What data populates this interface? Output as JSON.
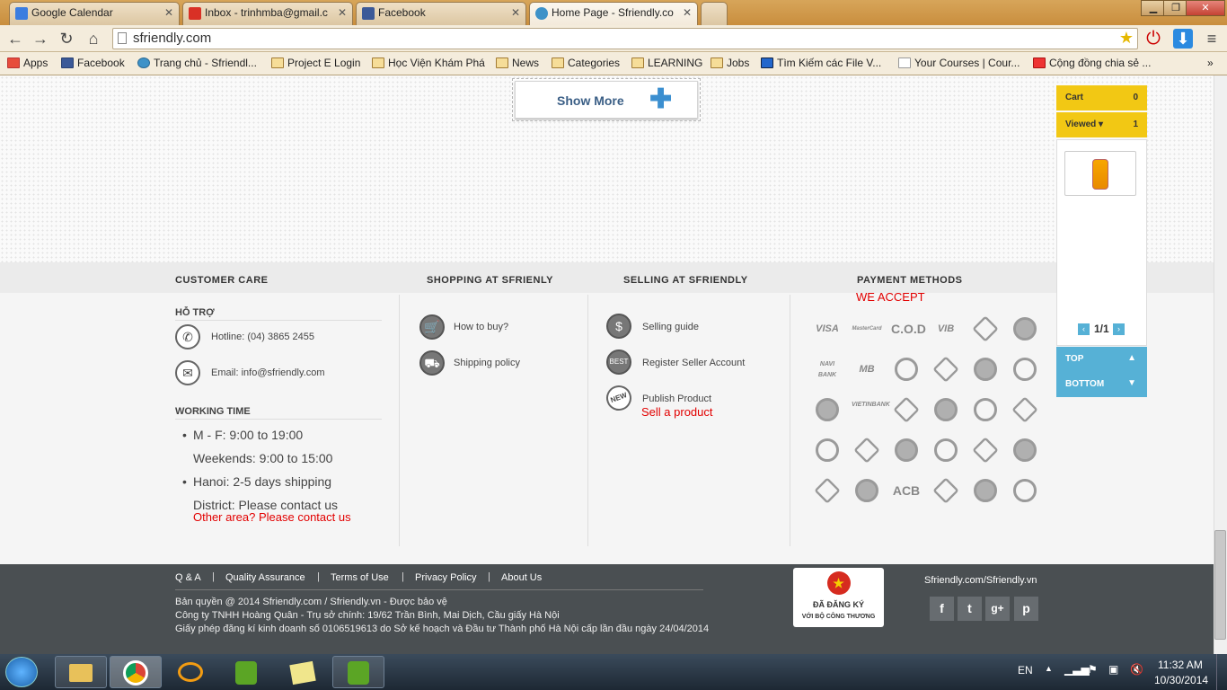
{
  "browser": {
    "tabs": [
      {
        "title": "Google Calendar",
        "favicon_color": "#3b7de0"
      },
      {
        "title": "Inbox - trinhmba@gmail.c",
        "favicon_color": "#d93025"
      },
      {
        "title": "Facebook",
        "favicon_color": "#3b5998"
      },
      {
        "title": "Home Page - Sfriendly.co",
        "favicon_color": "#3e92c8"
      }
    ],
    "url": "sfriendly.com",
    "bookmarks": [
      "Apps",
      "Facebook",
      "Trang chủ - Sfriendl...",
      "Project E Login",
      "Học Viện Khám Phá",
      "News",
      "Categories",
      "LEARNING",
      "Jobs",
      "Tìm Kiếm các File V...",
      "Your Courses | Cour...",
      "Cộng đồng chia sẻ ..."
    ]
  },
  "page": {
    "show_more": "Show More",
    "columns": {
      "customer_care": "CUSTOMER CARE",
      "shopping": "SHOPPING AT SFRIENLY",
      "selling": "SELLING AT SFRIENDLY",
      "payment": "PAYMENT METHODS"
    },
    "we_accept": "WE ACCEPT",
    "support": {
      "heading": "HỖ TRỢ",
      "hotline": "Hotline: (04) 3865 2455",
      "email": "Email: info@sfriendly.com"
    },
    "working": {
      "heading": "WORKING TIME",
      "line1": "M - F: 9:00 to 19:00",
      "line2": "Weekends: 9:00 to 15:00",
      "line3": "Hanoi: 2-5 days shipping",
      "line4": "District: Please contact us",
      "line5": "Other area? Please contact us"
    },
    "shopping_links": [
      "How to buy?",
      "Shipping policy"
    ],
    "selling_links": [
      "Selling guide",
      "Register Seller Account",
      "Publish Product"
    ],
    "sell_product": "Sell a product",
    "payment_icons": [
      [
        "VISA",
        "MasterCard",
        "C.O.D",
        "VIB",
        "bank-a",
        "bank-b"
      ],
      [
        "NAVI BANK",
        "MB",
        "bank-c",
        "bank-d",
        "bank-e",
        "bank-f"
      ],
      [
        "bank-g",
        "VIETINBANK",
        "bank-h",
        "bank-i",
        "bank-j",
        "bank-k"
      ],
      [
        "bank-l",
        "bank-m",
        "bank-n",
        "bank-o",
        "bank-p",
        "bank-q"
      ],
      [
        "bank-r",
        "bank-s",
        "ACB",
        "bank-t",
        "bank-u",
        "bank-v"
      ]
    ]
  },
  "footer": {
    "links": [
      "Q & A",
      "Quality Assurance",
      "Terms of Use",
      "Privacy Policy",
      "About Us"
    ],
    "copyright": "Bản quyền @ 2014 Sfriendly.com / Sfriendly.vn - Được bảo vệ",
    "company": "Công ty TNHH Hoàng Quân - Trụ sở chính: 19/62 Trần Bình, Mai Dịch, Cầu giấy Hà Nội",
    "license": "Giấy phép đăng kí kinh doanh số 0106519613 do Sở kế hoạch và Đầu tư Thành phố Hà Nội cấp lần đầu ngày 24/04/2014",
    "cert_line1": "ĐÃ ĐĂNG KÝ",
    "cert_line2": "VỚI BỘ CÔNG THƯƠNG",
    "site": "Sfriendly.com/Sfriendly.vn",
    "social": [
      "f",
      "t",
      "g+",
      "p"
    ]
  },
  "widget": {
    "cart_label": "Cart",
    "cart_count": "0",
    "viewed_label": "Viewed",
    "viewed_count": "1",
    "pager": "1/1",
    "top": "TOP",
    "bottom": "BOTTOM"
  },
  "taskbar": {
    "lang": "EN",
    "time": "11:32 AM",
    "date": "10/30/2014"
  }
}
